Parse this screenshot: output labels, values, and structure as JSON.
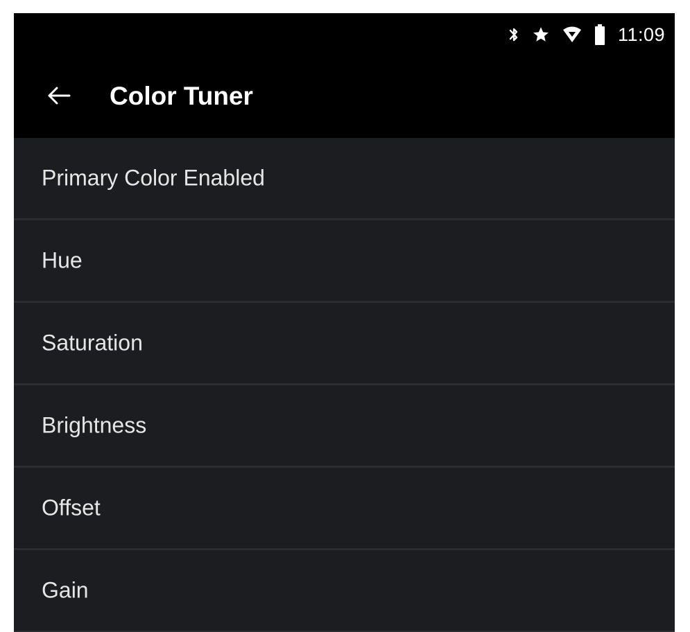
{
  "status_bar": {
    "time": "11:09",
    "icons": [
      "bluetooth-icon",
      "star-icon",
      "wifi-icon",
      "battery-icon"
    ]
  },
  "header": {
    "title": "Color Tuner",
    "back_icon": "arrow-back-icon"
  },
  "menu": {
    "items": [
      {
        "label": "Primary Color Enabled"
      },
      {
        "label": "Hue"
      },
      {
        "label": "Saturation"
      },
      {
        "label": "Brightness"
      },
      {
        "label": "Offset"
      },
      {
        "label": "Gain"
      }
    ]
  },
  "colors": {
    "background": "#000000",
    "list_background": "#1b1d20",
    "divider": "#2a2d31",
    "text": "#e6e6e6"
  }
}
